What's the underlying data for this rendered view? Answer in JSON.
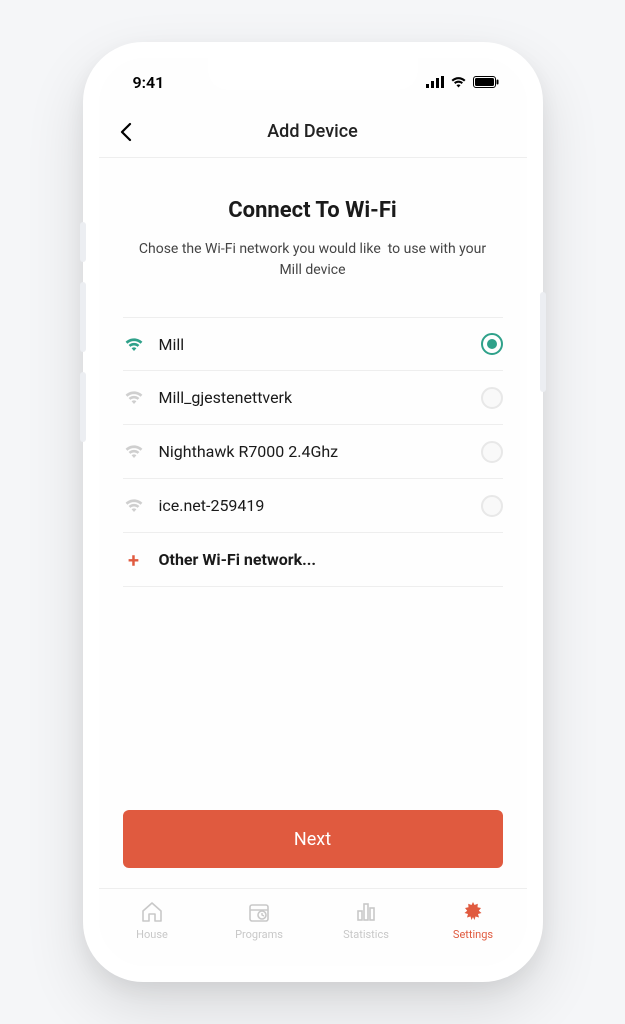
{
  "status": {
    "time": "9:41"
  },
  "header": {
    "title": "Add Device"
  },
  "page": {
    "heading": "Connect To Wi-Fi",
    "subtitle": "Chose the Wi-Fi network you would like  to use with your Mill device"
  },
  "networks": [
    {
      "name": "Mill",
      "selected": true
    },
    {
      "name": "Mill_gjestenettverk",
      "selected": false
    },
    {
      "name": "Nighthawk R7000 2.4Ghz",
      "selected": false
    },
    {
      "name": "ice.net-259419",
      "selected": false
    }
  ],
  "other_label": "Other Wi-Fi network...",
  "next_label": "Next",
  "tabs": [
    {
      "label": "House"
    },
    {
      "label": "Programs"
    },
    {
      "label": "Statistics"
    },
    {
      "label": "Settings"
    }
  ],
  "colors": {
    "accent": "#e05a3f",
    "selected": "#2fa18a"
  }
}
